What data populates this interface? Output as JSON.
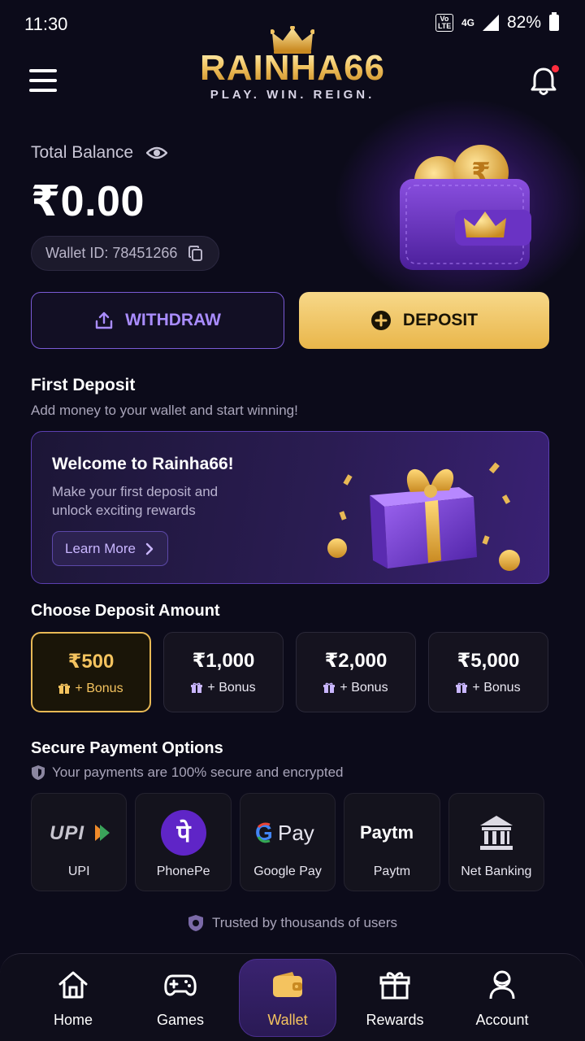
{
  "status_bar": {
    "time": "11:30",
    "volte": "Vo LTE",
    "network": "4G",
    "battery": "82%"
  },
  "header": {
    "brand": "RAINHA66",
    "tagline": "PLAY. WIN. REIGN."
  },
  "balance": {
    "label": "Total Balance",
    "amount": "₹0.00",
    "wallet_id": "Wallet ID: 78451266"
  },
  "actions": {
    "withdraw": "WITHDRAW",
    "deposit": "DEPOSIT"
  },
  "first_deposit": {
    "title": "First Deposit",
    "subtitle": "Add money to your wallet and start winning!",
    "promo_title": "Welcome to Rainha66!",
    "promo_text": "Make your first deposit and unlock exciting rewards",
    "learn_more": "Learn More"
  },
  "deposit_amounts": {
    "title": "Choose Deposit Amount",
    "options": [
      {
        "value": "₹500",
        "bonus": "+ Bonus",
        "selected": true
      },
      {
        "value": "₹1,000",
        "bonus": "+ Bonus",
        "selected": false
      },
      {
        "value": "₹2,000",
        "bonus": "+ Bonus",
        "selected": false
      },
      {
        "value": "₹5,000",
        "bonus": "+ Bonus",
        "selected": false
      }
    ]
  },
  "payment_options": {
    "title": "Secure Payment Options",
    "subtitle": "Your payments are 100% secure and encrypted",
    "methods": [
      {
        "label": "UPI",
        "logo_text": "UPI"
      },
      {
        "label": "PhonePe",
        "logo_text": "पे"
      },
      {
        "label": "Google Pay",
        "logo_text": "Pay"
      },
      {
        "label": "Paytm",
        "logo_text": "Paytm"
      },
      {
        "label": "Net Banking",
        "logo_text": ""
      }
    ]
  },
  "trusted": "Trusted by thousands of users",
  "bottom_nav": [
    {
      "label": "Home",
      "icon": "home-icon"
    },
    {
      "label": "Games",
      "icon": "gamepad-icon"
    },
    {
      "label": "Wallet",
      "icon": "wallet-icon",
      "active": true
    },
    {
      "label": "Rewards",
      "icon": "gift-icon"
    },
    {
      "label": "Account",
      "icon": "user-icon"
    }
  ],
  "colors": {
    "background": "#0c0b1a",
    "gold": "#f4c35f",
    "purple": "#7a5bd6"
  }
}
